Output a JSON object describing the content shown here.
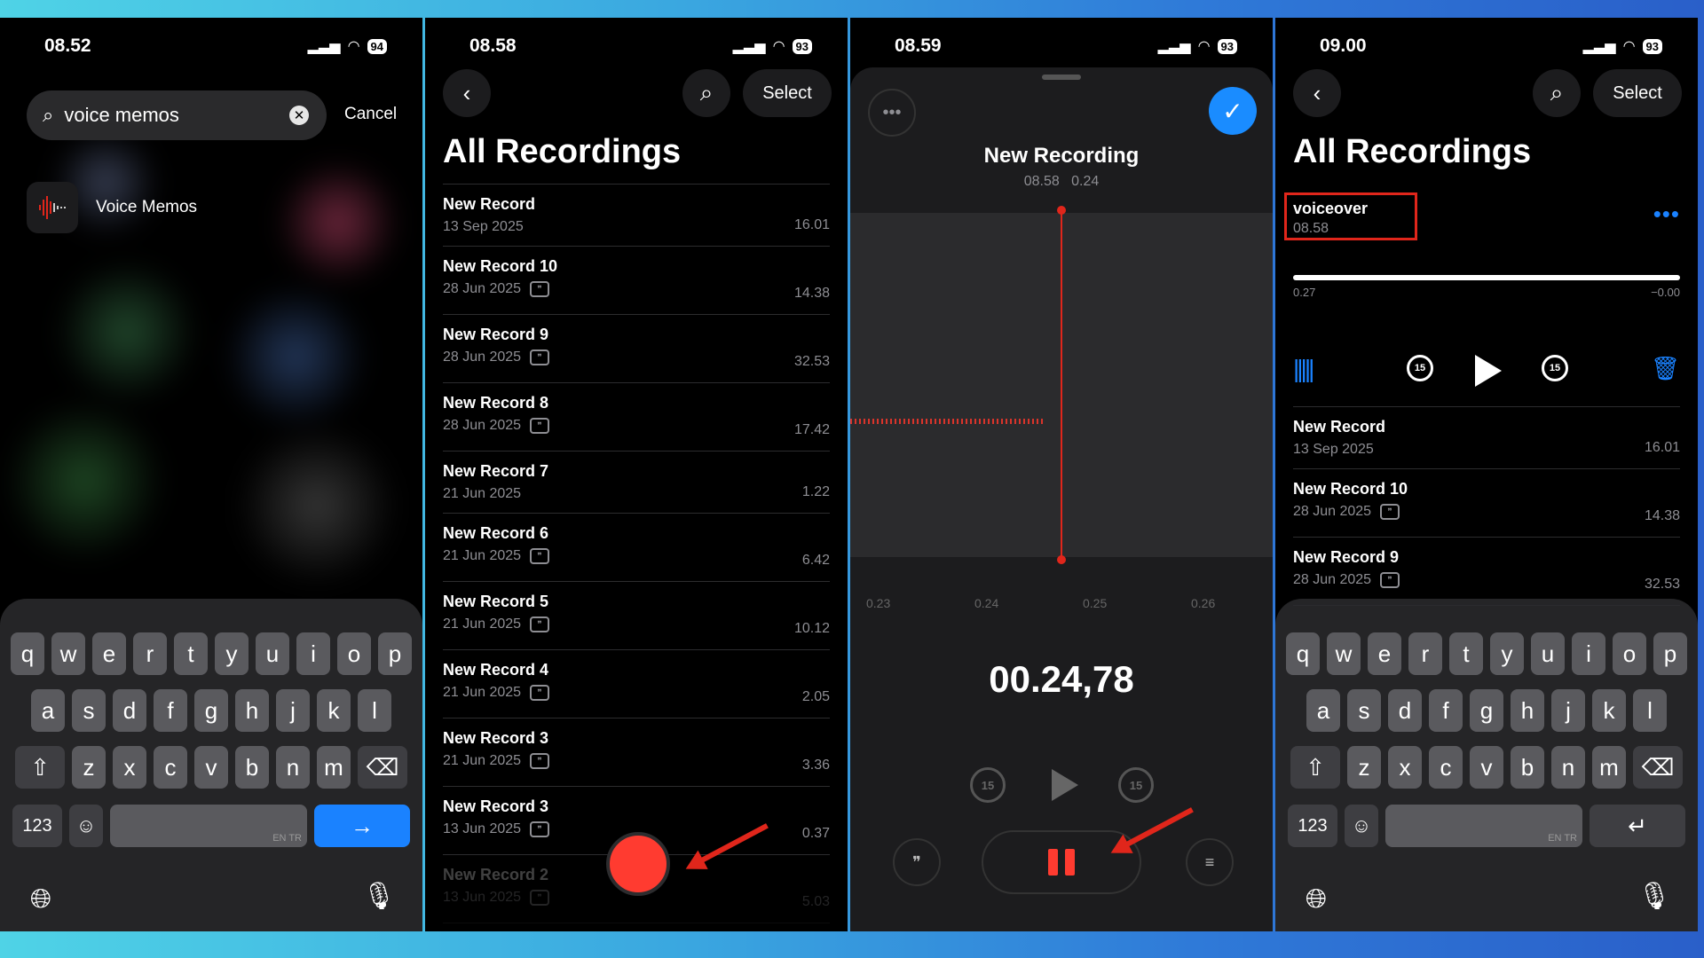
{
  "panel1": {
    "time": "08.52",
    "battery": "94",
    "search_value": "voice memos",
    "cancel_label": "Cancel",
    "result_label": "Voice Memos",
    "keys_row1": [
      "q",
      "w",
      "e",
      "r",
      "t",
      "y",
      "u",
      "i",
      "o",
      "p"
    ],
    "keys_row2": [
      "a",
      "s",
      "d",
      "f",
      "g",
      "h",
      "j",
      "k",
      "l"
    ],
    "keys_row3": [
      "z",
      "x",
      "c",
      "v",
      "b",
      "n",
      "m"
    ],
    "numbers_key": "123",
    "space_hint": "EN TR"
  },
  "panel2": {
    "time": "08.58",
    "battery": "93",
    "select_label": "Select",
    "title": "All Recordings",
    "recordings": [
      {
        "name": "New Record",
        "date": "13 Sep 2025",
        "duration": "16.01",
        "transcript": false
      },
      {
        "name": "New Record 10",
        "date": "28 Jun 2025",
        "duration": "14.38",
        "transcript": true
      },
      {
        "name": "New Record 9",
        "date": "28 Jun 2025",
        "duration": "32.53",
        "transcript": true
      },
      {
        "name": "New Record 8",
        "date": "28 Jun 2025",
        "duration": "17.42",
        "transcript": true
      },
      {
        "name": "New Record 7",
        "date": "21 Jun 2025",
        "duration": "1.22",
        "transcript": false
      },
      {
        "name": "New Record 6",
        "date": "21 Jun 2025",
        "duration": "6.42",
        "transcript": true
      },
      {
        "name": "New Record 5",
        "date": "21 Jun 2025",
        "duration": "10.12",
        "transcript": true
      },
      {
        "name": "New Record 4",
        "date": "21 Jun 2025",
        "duration": "2.05",
        "transcript": true
      },
      {
        "name": "New Record 3",
        "date": "21 Jun 2025",
        "duration": "3.36",
        "transcript": true
      },
      {
        "name": "New Record 3",
        "date": "13 Jun 2025",
        "duration": "0.37",
        "transcript": true
      },
      {
        "name": "New Record 2",
        "date": "13 Jun 2025",
        "duration": "5.03",
        "transcript": true
      }
    ]
  },
  "panel3": {
    "time": "08.59",
    "battery": "93",
    "title": "New Recording",
    "subtitle_time": "08.58",
    "subtitle_length": "0.24",
    "ticks": [
      "0.23",
      "0.24",
      "0.25",
      "0.26"
    ],
    "timer": "00.24,78",
    "skip_label": "15"
  },
  "panel4": {
    "time": "09.00",
    "battery": "93",
    "select_label": "Select",
    "title": "All Recordings",
    "current_name": "voiceover",
    "current_time": "08.58",
    "elapsed": "0.27",
    "remaining": "−0.00",
    "skip_label": "15",
    "recordings": [
      {
        "name": "New Record",
        "date": "13 Sep 2025",
        "duration": "16.01",
        "transcript": false
      },
      {
        "name": "New Record 10",
        "date": "28 Jun 2025",
        "duration": "14.38",
        "transcript": true
      },
      {
        "name": "New Record 9",
        "date": "28 Jun 2025",
        "duration": "32.53",
        "transcript": true
      }
    ],
    "keys_row1": [
      "q",
      "w",
      "e",
      "r",
      "t",
      "y",
      "u",
      "i",
      "o",
      "p"
    ],
    "keys_row2": [
      "a",
      "s",
      "d",
      "f",
      "g",
      "h",
      "j",
      "k",
      "l"
    ],
    "keys_row3": [
      "z",
      "x",
      "c",
      "v",
      "b",
      "n",
      "m"
    ],
    "numbers_key": "123",
    "space_hint": "EN TR"
  },
  "colors": {
    "accent_blue": "#1a82ff",
    "record_red": "#ff3b30",
    "annotation_red": "#e0261b"
  }
}
